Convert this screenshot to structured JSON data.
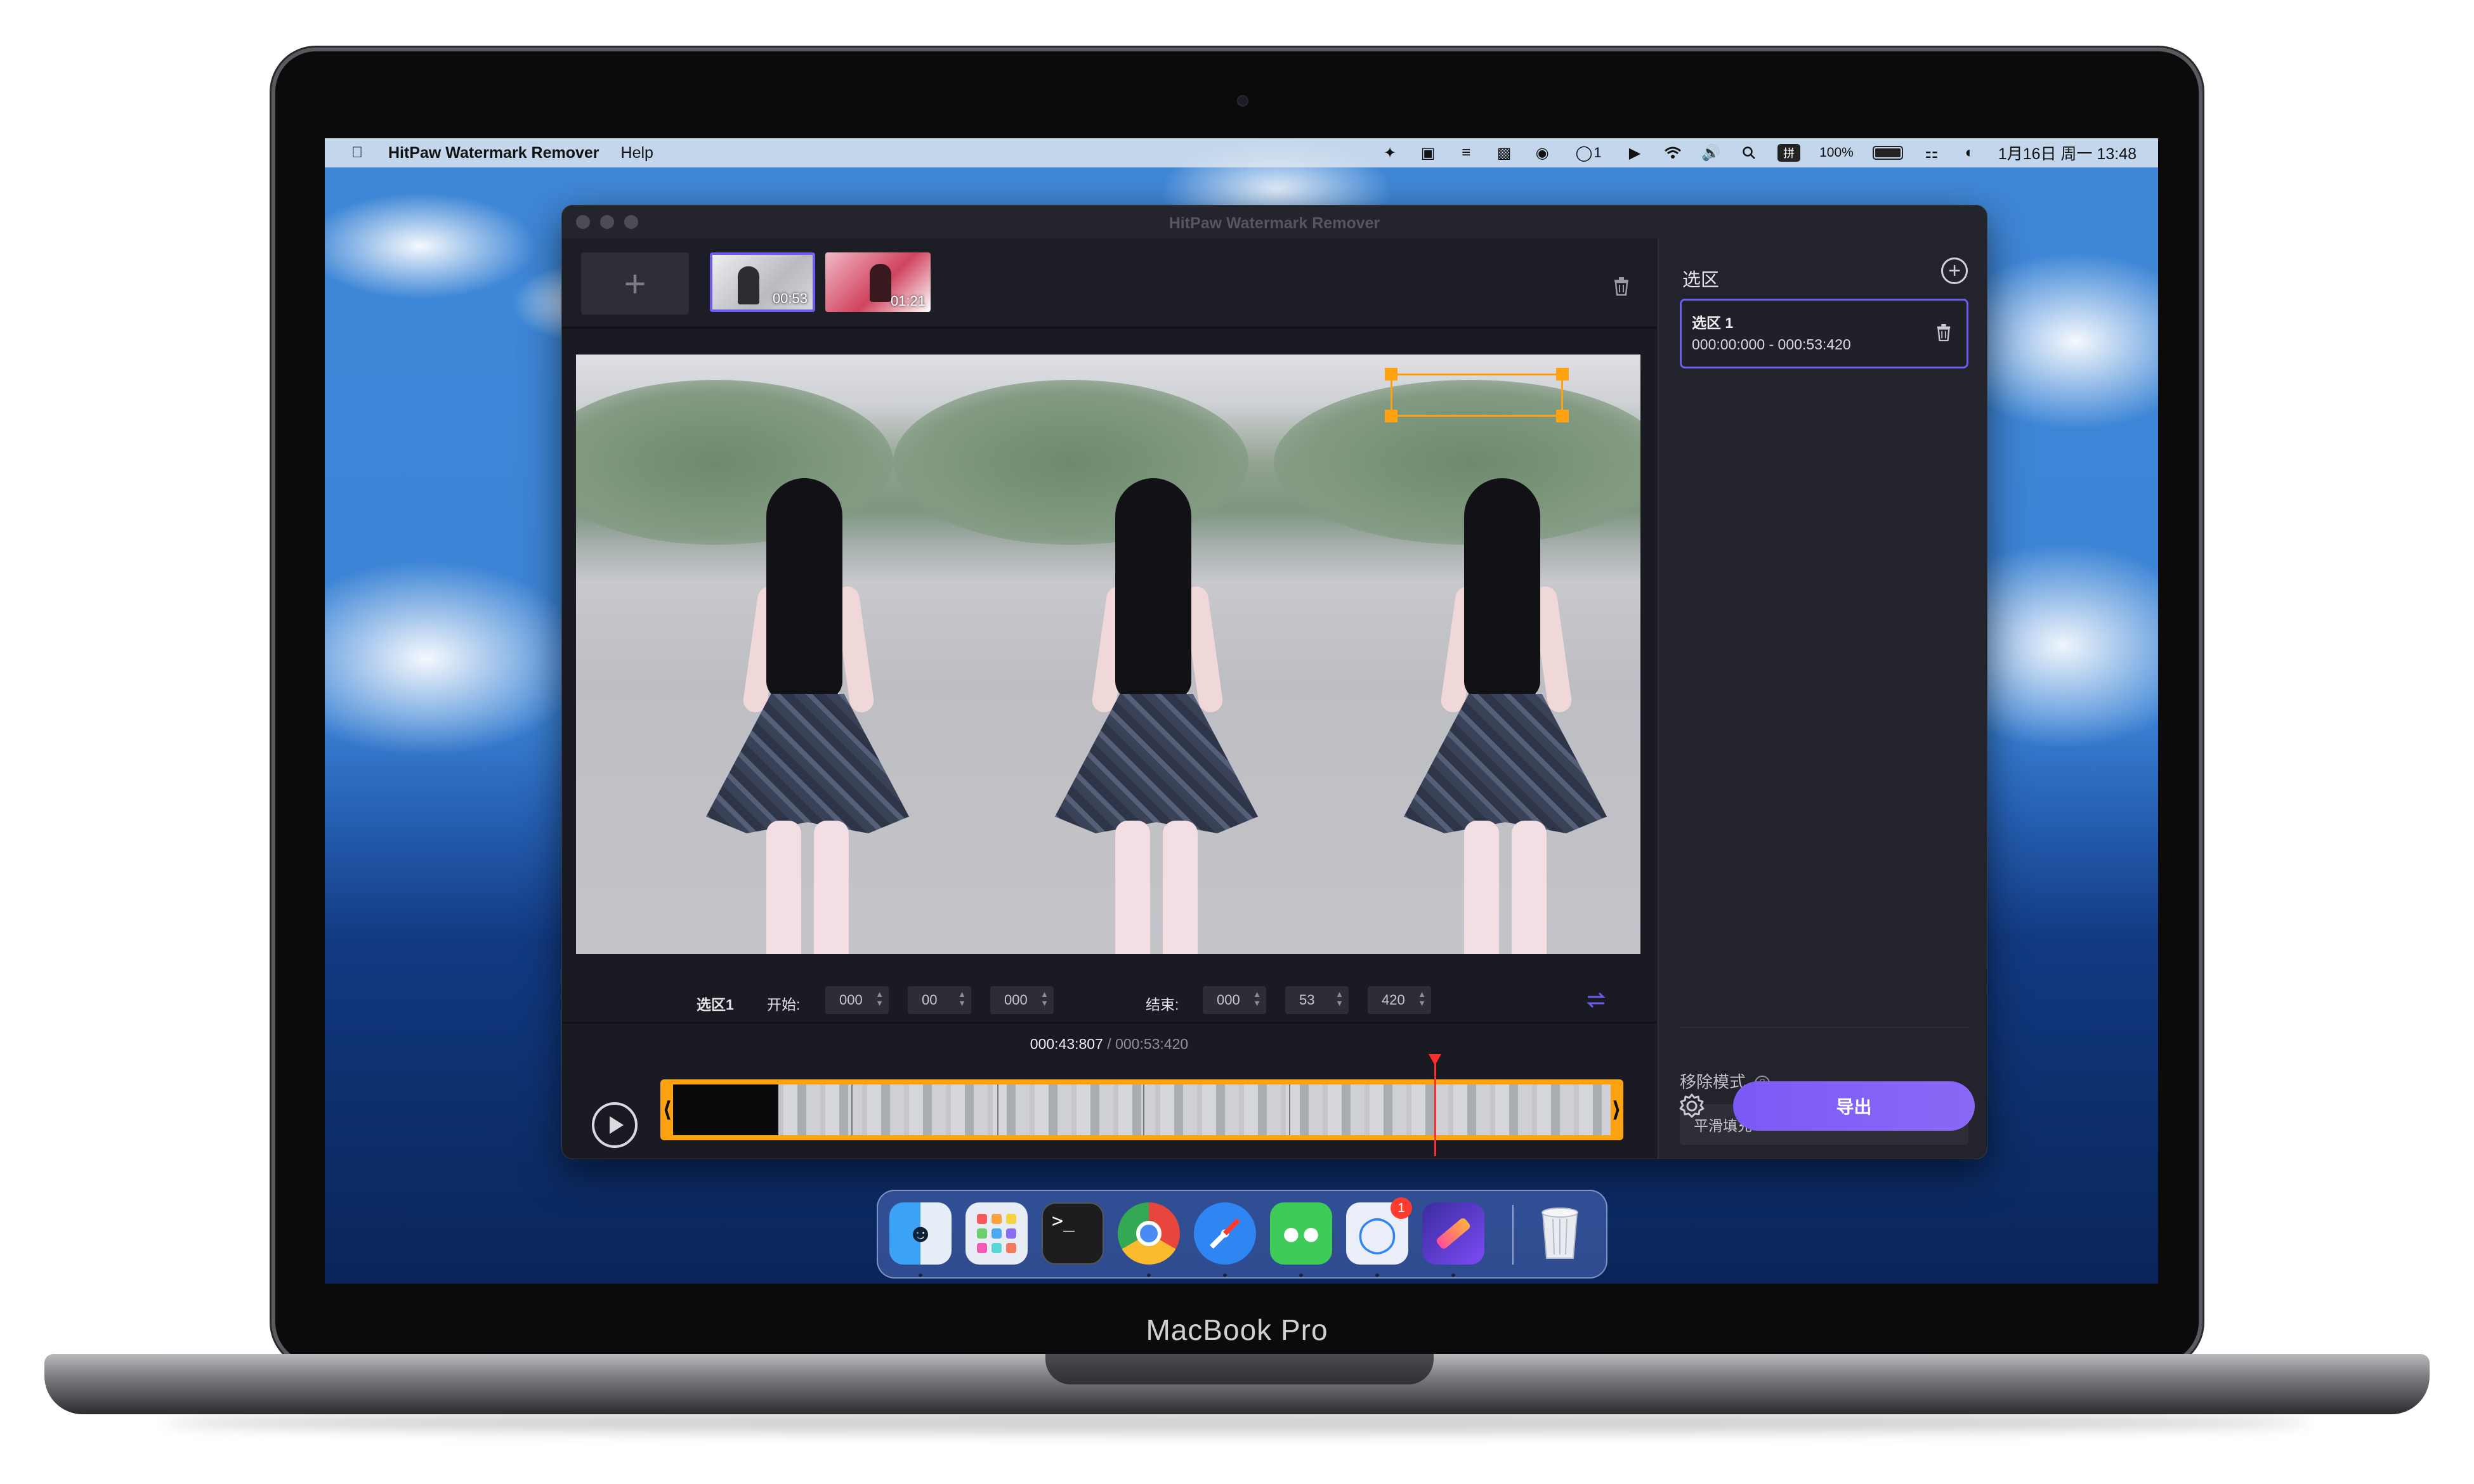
{
  "device": {
    "brand_label": "MacBook Pro"
  },
  "menubar": {
    "app_name": "HitPaw Watermark Remover",
    "menu_items": [
      "Help"
    ],
    "status": {
      "battery_percent": "100%",
      "datetime": "1月16日 周一  13:48",
      "ime": "拼",
      "notifications_count": "1"
    }
  },
  "window": {
    "title": "HitPaw Watermark Remover"
  },
  "media_strip": {
    "add_label": "+",
    "thumbnails": [
      {
        "duration": "00:53",
        "selected": true
      },
      {
        "duration": "01:21",
        "selected": false
      }
    ]
  },
  "time_row": {
    "region_label": "选区1",
    "start_label": "开始:",
    "start_values": [
      "000",
      "00",
      "000"
    ],
    "end_label": "结束:",
    "end_values": [
      "000",
      "53",
      "420"
    ]
  },
  "playback": {
    "current": "000:43:807",
    "separator": " / ",
    "total": "000:53:420",
    "progress": 0.82
  },
  "right_panel": {
    "title": "选区",
    "regions": [
      {
        "name": "选区 1",
        "range": "000:00:000 - 000:53:420"
      }
    ],
    "mode_label": "移除模式",
    "mode_value": "平滑填充",
    "export_label": "导出"
  },
  "dock": {
    "apps": [
      "finder-icon",
      "launchpad-icon",
      "terminal-icon",
      "chrome-icon",
      "safari-icon",
      "wechat-icon",
      "messages-icon",
      "hitpaw-icon",
      "trash-icon"
    ],
    "badge": "1"
  },
  "colors": {
    "accent": "#6d5cf0",
    "selection": "#ffa210",
    "playhead": "#ff2e2e",
    "export": "#7b5af5"
  }
}
